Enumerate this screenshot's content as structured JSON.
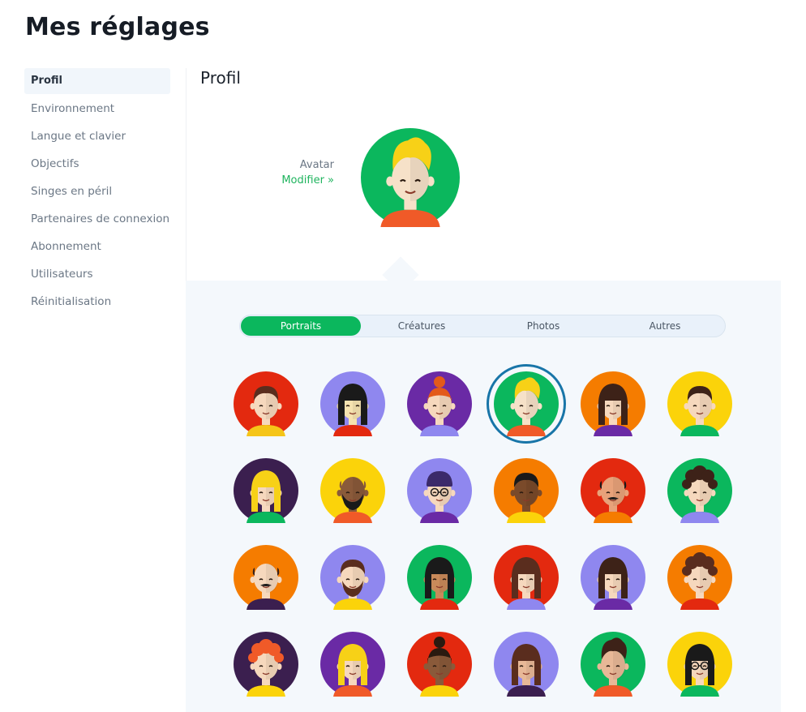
{
  "page": {
    "title": "Mes réglages"
  },
  "sidebar": {
    "items": [
      {
        "label": "Profil",
        "active": true
      },
      {
        "label": "Environnement"
      },
      {
        "label": "Langue et clavier"
      },
      {
        "label": "Objectifs"
      },
      {
        "label": "Singes en péril"
      },
      {
        "label": "Partenaires de connexion"
      },
      {
        "label": "Abonnement"
      },
      {
        "label": "Utilisateurs"
      },
      {
        "label": "Réinitialisation"
      }
    ]
  },
  "profile": {
    "title": "Profil",
    "avatar_label": "Avatar",
    "edit_link": "Modifier »"
  },
  "tabs": [
    {
      "label": "Portraits",
      "active": true
    },
    {
      "label": "Créatures"
    },
    {
      "label": "Photos"
    },
    {
      "label": "Autres"
    }
  ],
  "colors": {
    "accent": "#0bb75d",
    "selected_ring": "#1875a8",
    "panel_bg": "#f4f8fc"
  },
  "avatars": [
    {
      "bg": "#e3290f",
      "skin": "#f6d8bd",
      "hair": "#5a2d1e",
      "style": "short",
      "shirt": "#f5c518"
    },
    {
      "bg": "#8f87ef",
      "skin": "#f6e3b0",
      "hair": "#1a1a1a",
      "style": "long",
      "shirt": "#e3290f"
    },
    {
      "bg": "#6a2aa5",
      "skin": "#f6d8bd",
      "hair": "#e35a1a",
      "style": "bun",
      "shirt": "#8f87ef"
    },
    {
      "bg": "#0bb75d",
      "skin": "#f6e1c8",
      "hair": "#f7d117",
      "style": "quiff",
      "shirt": "#f05a28",
      "selected": true
    },
    {
      "bg": "#f57c00",
      "skin": "#f6d8bd",
      "hair": "#3d2218",
      "style": "long",
      "shirt": "#6a2aa5"
    },
    {
      "bg": "#fbd30a",
      "skin": "#f6d8bd",
      "hair": "#3d2218",
      "style": "short",
      "shirt": "#0bb75d"
    },
    {
      "bg": "#3b1f4f",
      "skin": "#f6d8bd",
      "hair": "#f7d117",
      "style": "long",
      "shirt": "#0bb75d"
    },
    {
      "bg": "#fbd30a",
      "skin": "#8a5a3a",
      "hair": "#8a5a3a",
      "style": "bald",
      "shirt": "#f05a28",
      "beard": "#1a1a1a"
    },
    {
      "bg": "#8f87ef",
      "skin": "#f6d8bd",
      "hair": "#3b2a6a",
      "style": "beanie",
      "shirt": "#6a2aa5",
      "glasses": true
    },
    {
      "bg": "#f57c00",
      "skin": "#7a4a2a",
      "hair": "#1a1a1a",
      "style": "short",
      "shirt": "#fbd30a"
    },
    {
      "bg": "#e3290f",
      "skin": "#e8a27a",
      "hair": "#1a1a1a",
      "style": "bald",
      "shirt": "#f57c00",
      "mustache": true
    },
    {
      "bg": "#0bb75d",
      "skin": "#f6d8bd",
      "hair": "#3d2218",
      "style": "curly",
      "shirt": "#8f87ef"
    },
    {
      "bg": "#f57c00",
      "skin": "#f6d8bd",
      "hair": "#3d2218",
      "style": "bald",
      "shirt": "#3b1f4f",
      "mustache": true
    },
    {
      "bg": "#8f87ef",
      "skin": "#f6d8bd",
      "hair": "#5a2d1e",
      "style": "short",
      "shirt": "#fbd30a",
      "beard": "#5a2d1e"
    },
    {
      "bg": "#0bb75d",
      "skin": "#c98a5a",
      "hair": "#1a1a1a",
      "style": "long",
      "shirt": "#e3290f"
    },
    {
      "bg": "#e3290f",
      "skin": "#f6d8bd",
      "hair": "#5a2d1e",
      "style": "long",
      "shirt": "#8f87ef"
    },
    {
      "bg": "#8f87ef",
      "skin": "#f6d8bd",
      "hair": "#3d2218",
      "style": "long",
      "shirt": "#6a2aa5"
    },
    {
      "bg": "#f57c00",
      "skin": "#f6d8bd",
      "hair": "#5a2d1e",
      "style": "curly",
      "shirt": "#e3290f"
    },
    {
      "bg": "#3b1f4f",
      "skin": "#f6d8bd",
      "hair": "#f05a28",
      "style": "curly",
      "shirt": "#fbd30a"
    },
    {
      "bg": "#6a2aa5",
      "skin": "#f6d8bd",
      "hair": "#f7d117",
      "style": "long",
      "shirt": "#f05a28"
    },
    {
      "bg": "#e3290f",
      "skin": "#8a5a3a",
      "hair": "#2a1a10",
      "style": "bun",
      "shirt": "#fbd30a"
    },
    {
      "bg": "#8f87ef",
      "skin": "#e8b897",
      "hair": "#5a2d1e",
      "style": "long",
      "shirt": "#3b1f4f"
    },
    {
      "bg": "#0bb75d",
      "skin": "#e8b897",
      "hair": "#3d2218",
      "style": "quiff",
      "shirt": "#f05a28"
    },
    {
      "bg": "#fbd30a",
      "skin": "#f6d8bd",
      "hair": "#1a1a1a",
      "style": "long",
      "shirt": "#0bb75d",
      "glasses": true
    }
  ]
}
